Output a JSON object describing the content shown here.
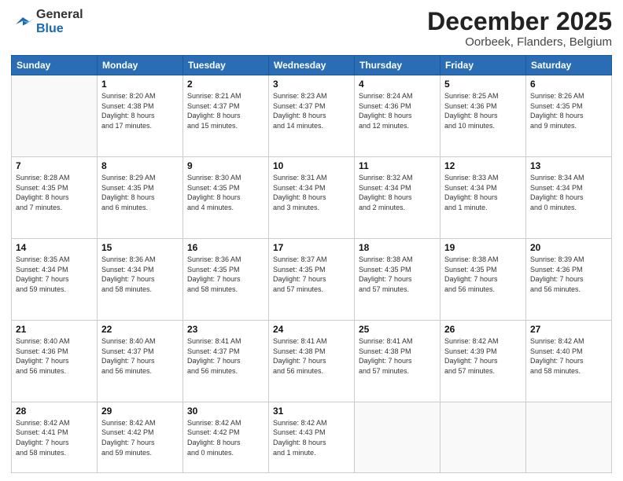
{
  "header": {
    "logo_general": "General",
    "logo_blue": "Blue",
    "month_title": "December 2025",
    "location": "Oorbeek, Flanders, Belgium"
  },
  "weekdays": [
    "Sunday",
    "Monday",
    "Tuesday",
    "Wednesday",
    "Thursday",
    "Friday",
    "Saturday"
  ],
  "weeks": [
    [
      {
        "day": "",
        "info": ""
      },
      {
        "day": "1",
        "info": "Sunrise: 8:20 AM\nSunset: 4:38 PM\nDaylight: 8 hours\nand 17 minutes."
      },
      {
        "day": "2",
        "info": "Sunrise: 8:21 AM\nSunset: 4:37 PM\nDaylight: 8 hours\nand 15 minutes."
      },
      {
        "day": "3",
        "info": "Sunrise: 8:23 AM\nSunset: 4:37 PM\nDaylight: 8 hours\nand 14 minutes."
      },
      {
        "day": "4",
        "info": "Sunrise: 8:24 AM\nSunset: 4:36 PM\nDaylight: 8 hours\nand 12 minutes."
      },
      {
        "day": "5",
        "info": "Sunrise: 8:25 AM\nSunset: 4:36 PM\nDaylight: 8 hours\nand 10 minutes."
      },
      {
        "day": "6",
        "info": "Sunrise: 8:26 AM\nSunset: 4:35 PM\nDaylight: 8 hours\nand 9 minutes."
      }
    ],
    [
      {
        "day": "7",
        "info": "Sunrise: 8:28 AM\nSunset: 4:35 PM\nDaylight: 8 hours\nand 7 minutes."
      },
      {
        "day": "8",
        "info": "Sunrise: 8:29 AM\nSunset: 4:35 PM\nDaylight: 8 hours\nand 6 minutes."
      },
      {
        "day": "9",
        "info": "Sunrise: 8:30 AM\nSunset: 4:35 PM\nDaylight: 8 hours\nand 4 minutes."
      },
      {
        "day": "10",
        "info": "Sunrise: 8:31 AM\nSunset: 4:34 PM\nDaylight: 8 hours\nand 3 minutes."
      },
      {
        "day": "11",
        "info": "Sunrise: 8:32 AM\nSunset: 4:34 PM\nDaylight: 8 hours\nand 2 minutes."
      },
      {
        "day": "12",
        "info": "Sunrise: 8:33 AM\nSunset: 4:34 PM\nDaylight: 8 hours\nand 1 minute."
      },
      {
        "day": "13",
        "info": "Sunrise: 8:34 AM\nSunset: 4:34 PM\nDaylight: 8 hours\nand 0 minutes."
      }
    ],
    [
      {
        "day": "14",
        "info": "Sunrise: 8:35 AM\nSunset: 4:34 PM\nDaylight: 7 hours\nand 59 minutes."
      },
      {
        "day": "15",
        "info": "Sunrise: 8:36 AM\nSunset: 4:34 PM\nDaylight: 7 hours\nand 58 minutes."
      },
      {
        "day": "16",
        "info": "Sunrise: 8:36 AM\nSunset: 4:35 PM\nDaylight: 7 hours\nand 58 minutes."
      },
      {
        "day": "17",
        "info": "Sunrise: 8:37 AM\nSunset: 4:35 PM\nDaylight: 7 hours\nand 57 minutes."
      },
      {
        "day": "18",
        "info": "Sunrise: 8:38 AM\nSunset: 4:35 PM\nDaylight: 7 hours\nand 57 minutes."
      },
      {
        "day": "19",
        "info": "Sunrise: 8:38 AM\nSunset: 4:35 PM\nDaylight: 7 hours\nand 56 minutes."
      },
      {
        "day": "20",
        "info": "Sunrise: 8:39 AM\nSunset: 4:36 PM\nDaylight: 7 hours\nand 56 minutes."
      }
    ],
    [
      {
        "day": "21",
        "info": "Sunrise: 8:40 AM\nSunset: 4:36 PM\nDaylight: 7 hours\nand 56 minutes."
      },
      {
        "day": "22",
        "info": "Sunrise: 8:40 AM\nSunset: 4:37 PM\nDaylight: 7 hours\nand 56 minutes."
      },
      {
        "day": "23",
        "info": "Sunrise: 8:41 AM\nSunset: 4:37 PM\nDaylight: 7 hours\nand 56 minutes."
      },
      {
        "day": "24",
        "info": "Sunrise: 8:41 AM\nSunset: 4:38 PM\nDaylight: 7 hours\nand 56 minutes."
      },
      {
        "day": "25",
        "info": "Sunrise: 8:41 AM\nSunset: 4:38 PM\nDaylight: 7 hours\nand 57 minutes."
      },
      {
        "day": "26",
        "info": "Sunrise: 8:42 AM\nSunset: 4:39 PM\nDaylight: 7 hours\nand 57 minutes."
      },
      {
        "day": "27",
        "info": "Sunrise: 8:42 AM\nSunset: 4:40 PM\nDaylight: 7 hours\nand 58 minutes."
      }
    ],
    [
      {
        "day": "28",
        "info": "Sunrise: 8:42 AM\nSunset: 4:41 PM\nDaylight: 7 hours\nand 58 minutes."
      },
      {
        "day": "29",
        "info": "Sunrise: 8:42 AM\nSunset: 4:42 PM\nDaylight: 7 hours\nand 59 minutes."
      },
      {
        "day": "30",
        "info": "Sunrise: 8:42 AM\nSunset: 4:42 PM\nDaylight: 8 hours\nand 0 minutes."
      },
      {
        "day": "31",
        "info": "Sunrise: 8:42 AM\nSunset: 4:43 PM\nDaylight: 8 hours\nand 1 minute."
      },
      {
        "day": "",
        "info": ""
      },
      {
        "day": "",
        "info": ""
      },
      {
        "day": "",
        "info": ""
      }
    ]
  ]
}
